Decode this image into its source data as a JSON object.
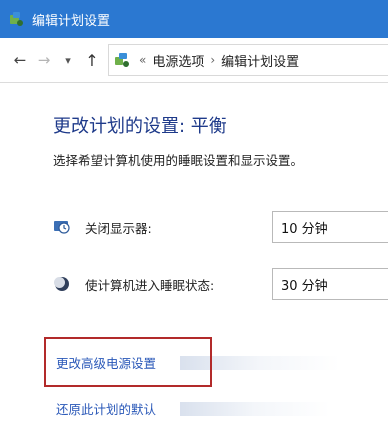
{
  "window": {
    "title": "编辑计划设置"
  },
  "addressbar": {
    "prefix": "«",
    "crumbs": [
      "电源选项",
      "编辑计划设置"
    ],
    "separator": "›"
  },
  "main": {
    "title": "更改计划的设置: 平衡",
    "subtitle": "选择希望计算机使用的睡眠设置和显示设置。",
    "settings": [
      {
        "label": "关闭显示器:",
        "value": "10 分钟",
        "icon": "monitor-clock-icon"
      },
      {
        "label": "使计算机进入睡眠状态:",
        "value": "30 分钟",
        "icon": "moon-icon"
      }
    ],
    "links": {
      "advanced": "更改高级电源设置",
      "restore": "还原此计划的默认"
    }
  },
  "colors": {
    "titlebar": "#2b78d1",
    "link": "#2a58b8",
    "highlight": "#b22a2a"
  }
}
